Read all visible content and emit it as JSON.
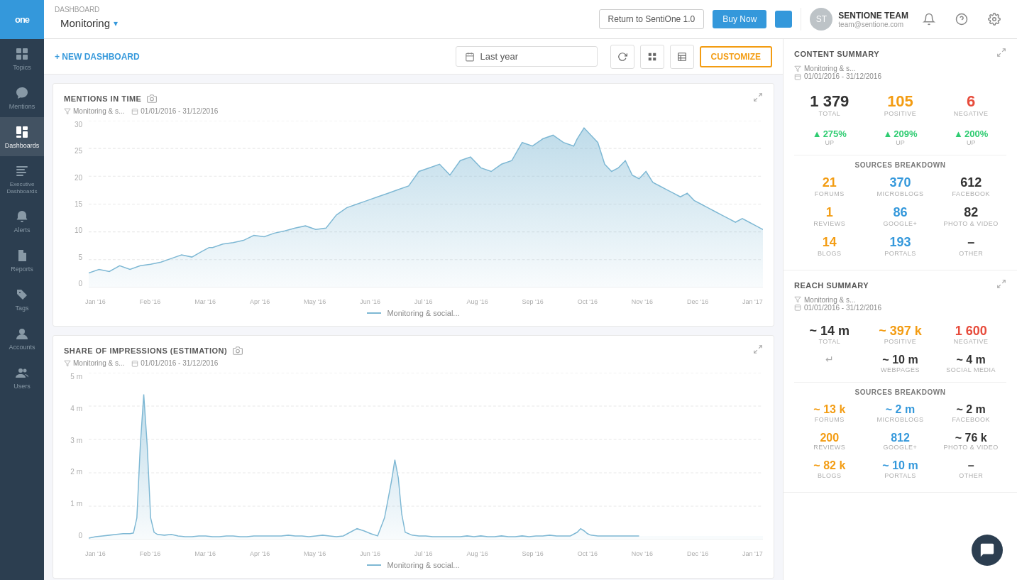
{
  "sidebar": {
    "logo": "one",
    "items": [
      {
        "id": "topics",
        "label": "Topics",
        "icon": "⊞"
      },
      {
        "id": "mentions",
        "label": "Mentions",
        "icon": "💬"
      },
      {
        "id": "dashboards",
        "label": "Dashboards",
        "icon": "▦",
        "active": true
      },
      {
        "id": "executive-dashboards",
        "label": "Executive Dashboards",
        "icon": "📋"
      },
      {
        "id": "alerts",
        "label": "Alerts",
        "icon": "🔔"
      },
      {
        "id": "reports",
        "label": "Reports",
        "icon": "📄"
      },
      {
        "id": "tags",
        "label": "Tags",
        "icon": "🏷"
      },
      {
        "id": "accounts",
        "label": "Accounts",
        "icon": "👤"
      },
      {
        "id": "users",
        "label": "Users",
        "icon": "👥"
      }
    ]
  },
  "topbar": {
    "breadcrumb": "DASHBOARD",
    "dashboard_name": "Monitoring",
    "return_btn": "Return to SentiOne 1.0",
    "buy_btn": "Buy Now",
    "user": {
      "name": "SENTIONE TEAM",
      "email": "team@sentione.com"
    }
  },
  "dash_toolbar": {
    "new_dashboard": "+ NEW DASHBOARD",
    "date_label": "Last year"
  },
  "customize_btn": "CUSTOMIZE",
  "mentions_chart": {
    "title": "MENTIONS IN TIME",
    "filter": "Monitoring & s...",
    "date_range": "01/01/2016 - 31/12/2016",
    "legend": "Monitoring & social...",
    "y_labels": [
      "0",
      "5",
      "10",
      "15",
      "20",
      "25",
      "30"
    ],
    "x_labels": [
      "Jan '16",
      "Feb '16",
      "Mar '16",
      "Apr '16",
      "May '16",
      "Jun '16",
      "Jul '16",
      "Aug '16",
      "Sep '16",
      "Oct '16",
      "Nov '16",
      "Dec '16",
      "Jan '17"
    ]
  },
  "impressions_chart": {
    "title": "SHARE OF IMPRESSIONS (ESTIMATION)",
    "filter": "Monitoring & s...",
    "date_range": "01/01/2016 - 31/12/2016",
    "legend": "Monitoring & social...",
    "y_labels": [
      "0",
      "1 m",
      "2 m",
      "3 m",
      "4 m",
      "5 m"
    ],
    "x_labels": [
      "Jan '16",
      "Feb '16",
      "Mar '16",
      "Apr '16",
      "May '16",
      "Jun '16",
      "Jul '16",
      "Aug '16",
      "Sep '16",
      "Oct '16",
      "Nov '16",
      "Dec '16",
      "Jan '17"
    ]
  },
  "content_summary": {
    "title": "CONTENT SUMMARY",
    "filter": "Monitoring & s...",
    "date_range": "01/01/2016 - 31/12/2016",
    "stats": {
      "total": {
        "value": "1 379",
        "label": "TOTAL"
      },
      "positive": {
        "value": "105",
        "label": "POSITIVE"
      },
      "negative": {
        "value": "6",
        "label": "NEGATIVE"
      },
      "total_change": {
        "value": "275%",
        "label": "UP"
      },
      "positive_change": {
        "value": "209%",
        "label": "UP"
      },
      "negative_change": {
        "value": "200%",
        "label": "UP"
      }
    },
    "sources": {
      "label": "SOURCES BREAKDOWN",
      "forums": {
        "value": "21",
        "label": "FORUMS"
      },
      "microblogs": {
        "value": "370",
        "label": "MICROBLOGS"
      },
      "facebook": {
        "value": "612",
        "label": "FACEBOOK"
      },
      "reviews": {
        "value": "1",
        "label": "REVIEWS"
      },
      "googleplus": {
        "value": "86",
        "label": "GOOGLE+"
      },
      "photovideo": {
        "value": "82",
        "label": "PHOTO & VIDEO"
      },
      "blogs": {
        "value": "14",
        "label": "BLOGS"
      },
      "portals": {
        "value": "193",
        "label": "PORTALS"
      },
      "other": {
        "value": "–",
        "label": "OTHER"
      }
    }
  },
  "reach_summary": {
    "title": "REACH SUMMARY",
    "filter": "Monitoring & s...",
    "date_range": "01/01/2016 - 31/12/2016",
    "stats": {
      "total": {
        "value": "~ 14 m",
        "label": "TOTAL"
      },
      "positive": {
        "value": "~ 397 k",
        "label": "POSITIVE"
      },
      "negative": {
        "value": "1 600",
        "label": "NEGATIVE"
      },
      "webpages": {
        "value": "~ 10 m",
        "label": "WEBPAGES"
      },
      "social_media": {
        "value": "~ 4 m",
        "label": "SOCIAL MEDIA"
      }
    },
    "sources": {
      "label": "SOURCES BREAKDOWN",
      "forums": {
        "value": "~ 13 k",
        "label": "FORUMS"
      },
      "microblogs": {
        "value": "~ 2 m",
        "label": "MICROBLOGS"
      },
      "facebook": {
        "value": "~ 2 m",
        "label": "FACEBOOK"
      },
      "reviews": {
        "value": "200",
        "label": "REVIEWS"
      },
      "googleplus": {
        "value": "812",
        "label": "GOOGLE+"
      },
      "photovideo": {
        "value": "~ 76 k",
        "label": "PHOTO & VIDEO"
      },
      "blogs": {
        "value": "~ 82 k",
        "label": "BLOGS"
      },
      "portals": {
        "value": "~ 10 m",
        "label": "PORTALS"
      },
      "other": {
        "value": "–",
        "label": "OTHER"
      }
    }
  }
}
